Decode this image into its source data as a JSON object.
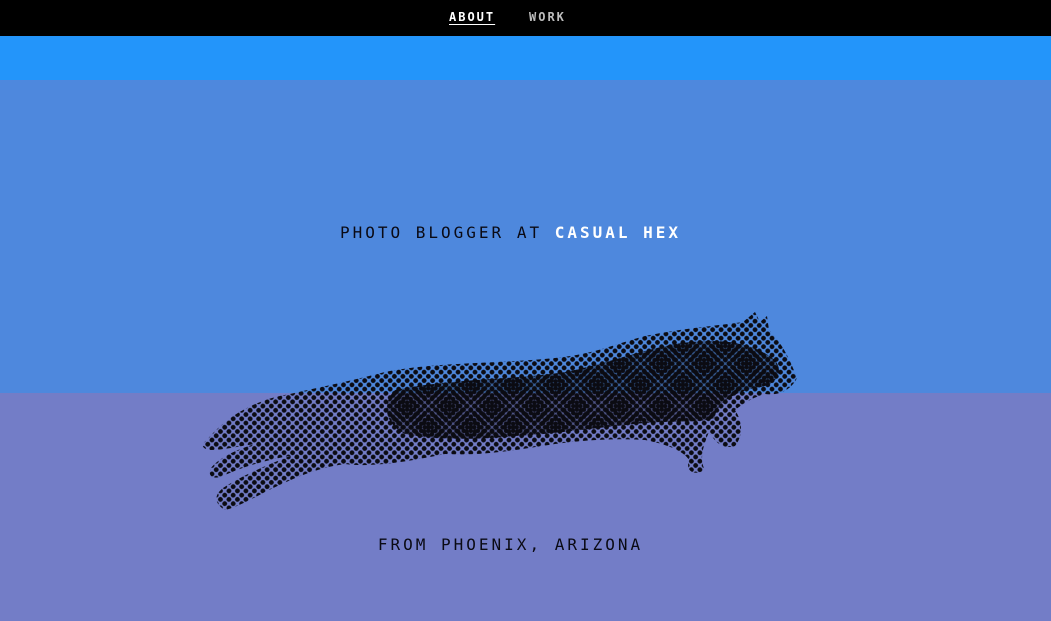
{
  "nav": {
    "about_label": "ABOUT",
    "work_label": "WORK"
  },
  "hero": {
    "tagline_prefix": "PHOTO BLOGGER AT",
    "brand_name": "CASUAL HEX",
    "location": "FROM PHOENIX, ARIZONA"
  },
  "image": {
    "subject": "leaping-cat-halftone"
  },
  "colors": {
    "nav_bg": "#000000",
    "band_top": "#2395fa",
    "band_mid": "#4e88dd",
    "band_bottom": "#737dc7",
    "brand_text": "#ffffff",
    "body_text": "#0a0a14"
  }
}
